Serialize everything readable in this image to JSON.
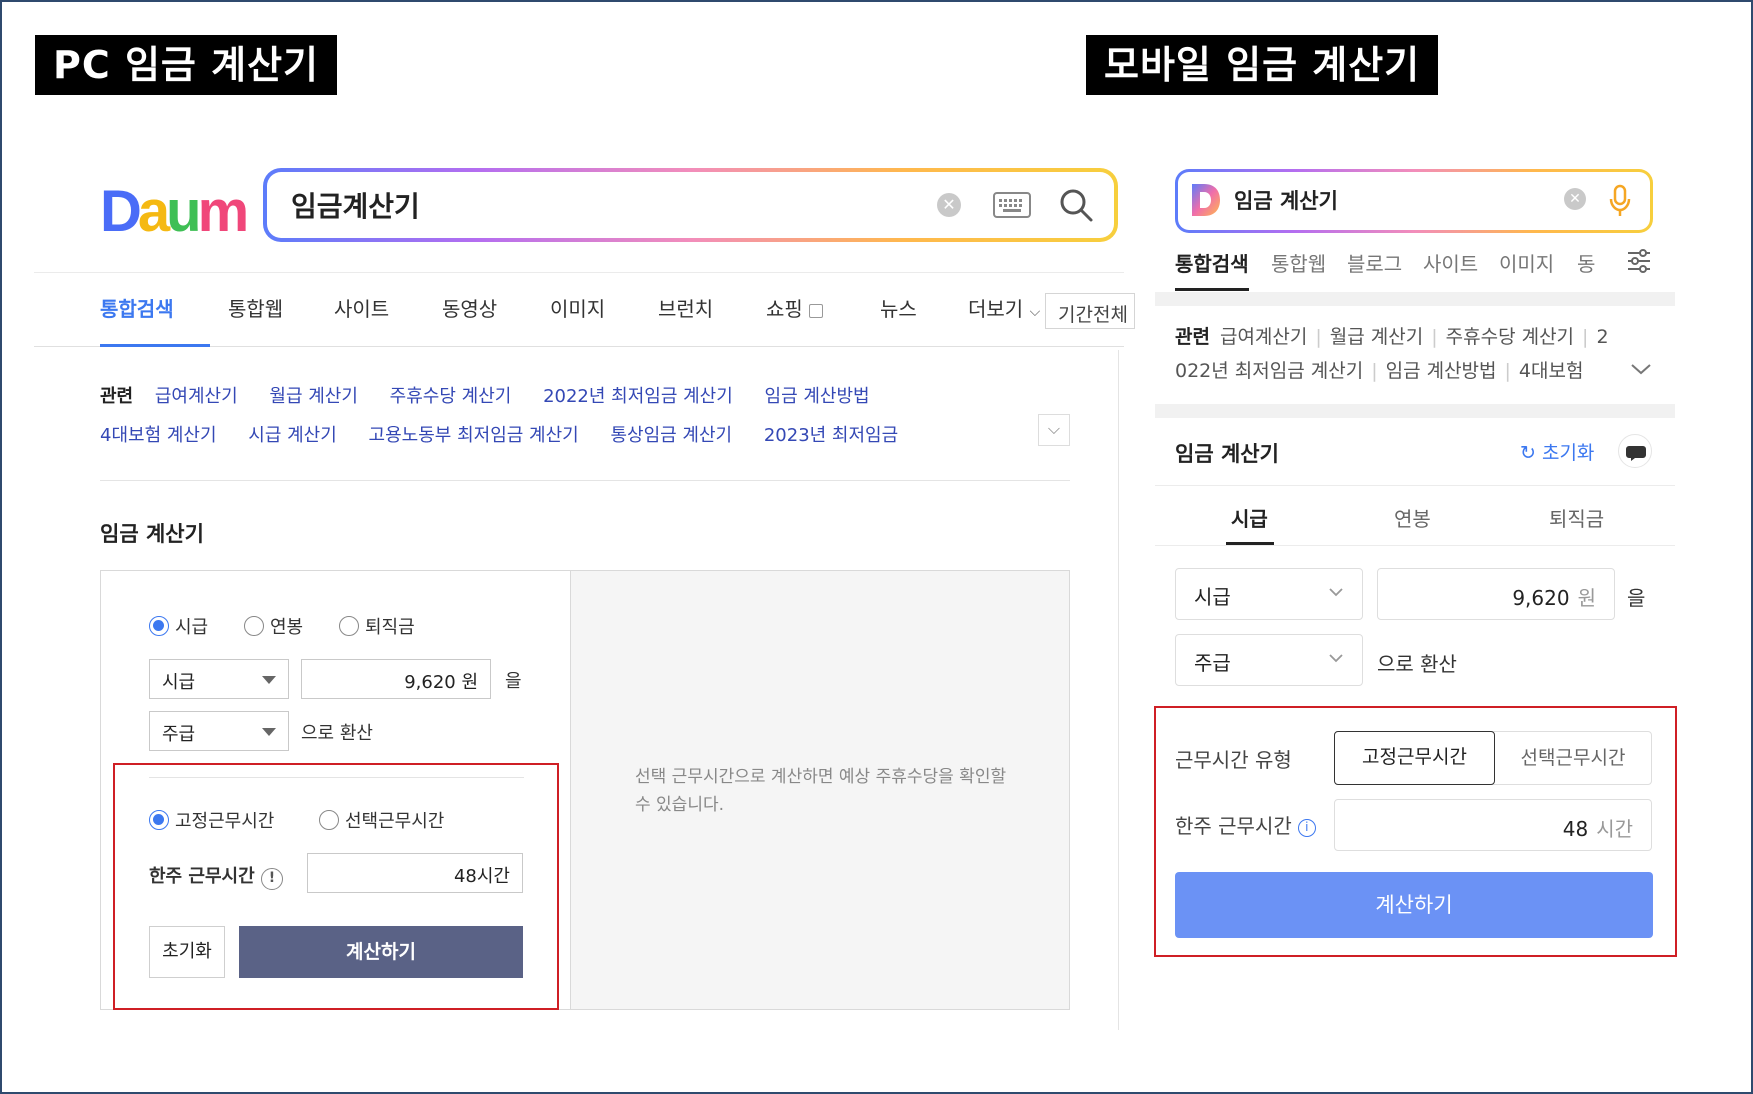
{
  "labels": {
    "pc": "PC 임금 계산기",
    "mobile": "모바일 임금 계산기"
  },
  "colors": {
    "accent": "#3c78f0",
    "pc_calc_button": "#5a6286",
    "mobile_calc_button": "#6b92f5",
    "highlight_box": "#cf1f25"
  },
  "pc": {
    "logo": {
      "d": "D",
      "a": "a",
      "u": "u",
      "m": "m"
    },
    "search": {
      "value": "임금계산기",
      "clear_icon": "clear-icon",
      "keyboard_icon": "keyboard-icon",
      "search_icon": "search-icon"
    },
    "tabs": [
      "통합검색",
      "통합웹",
      "사이트",
      "동영상",
      "이미지",
      "브런치",
      "쇼핑",
      "뉴스",
      "더보기"
    ],
    "period": "기간전체",
    "related": {
      "title": "관련",
      "row1": [
        "급여계산기",
        "월급 계산기",
        "주휴수당 계산기",
        "2022년 최저임금 계산기",
        "임금 계산방법"
      ],
      "row2": [
        "4대보험 계산기",
        "시급 계산기",
        "고용노동부 최저임금 계산기",
        "통상임금 계산기",
        "2023년 최저임금"
      ]
    },
    "calc": {
      "title": "임금 계산기",
      "types": [
        "시급",
        "연봉",
        "퇴직금"
      ],
      "from_select": "시급",
      "amount": "9,620 원",
      "particle": "을",
      "to_select": "주급",
      "convert_text": "으로 환산",
      "work_types": [
        "고정근무시간",
        "선택근무시간"
      ],
      "weekly_hours_label": "한주 근무시간",
      "weekly_hours": "48시간",
      "reset_label": "초기화",
      "calc_label": "계산하기",
      "notice": "선택 근무시간으로 계산하면 예상 주휴수당을 확인할 수 있습니다."
    }
  },
  "mobile": {
    "search": {
      "value": "임금 계산기"
    },
    "tabs": [
      "통합검색",
      "통합웹",
      "블로그",
      "사이트",
      "이미지",
      "동영상"
    ],
    "related": {
      "title": "관련",
      "line1": [
        "급여계산기",
        "월급 계산기",
        "주휴수당 계산기",
        "2"
      ],
      "line2": [
        "022년 최저임금 계산기",
        "임금 계산방법",
        "4대보험"
      ]
    },
    "calc": {
      "title": "임금 계산기",
      "reset_label": "초기화",
      "subtabs": [
        "시급",
        "연봉",
        "퇴직금"
      ],
      "from_select": "시급",
      "amount": "9,620",
      "amount_unit": "원",
      "particle": "을",
      "to_select": "주급",
      "convert_text": "으로 환산",
      "work_type_label": "근무시간 유형",
      "work_types": [
        "고정근무시간",
        "선택근무시간"
      ],
      "weekly_hours_label": "한주 근무시간",
      "weekly_hours": "48",
      "hours_unit": "시간",
      "calc_label": "계산하기"
    }
  }
}
